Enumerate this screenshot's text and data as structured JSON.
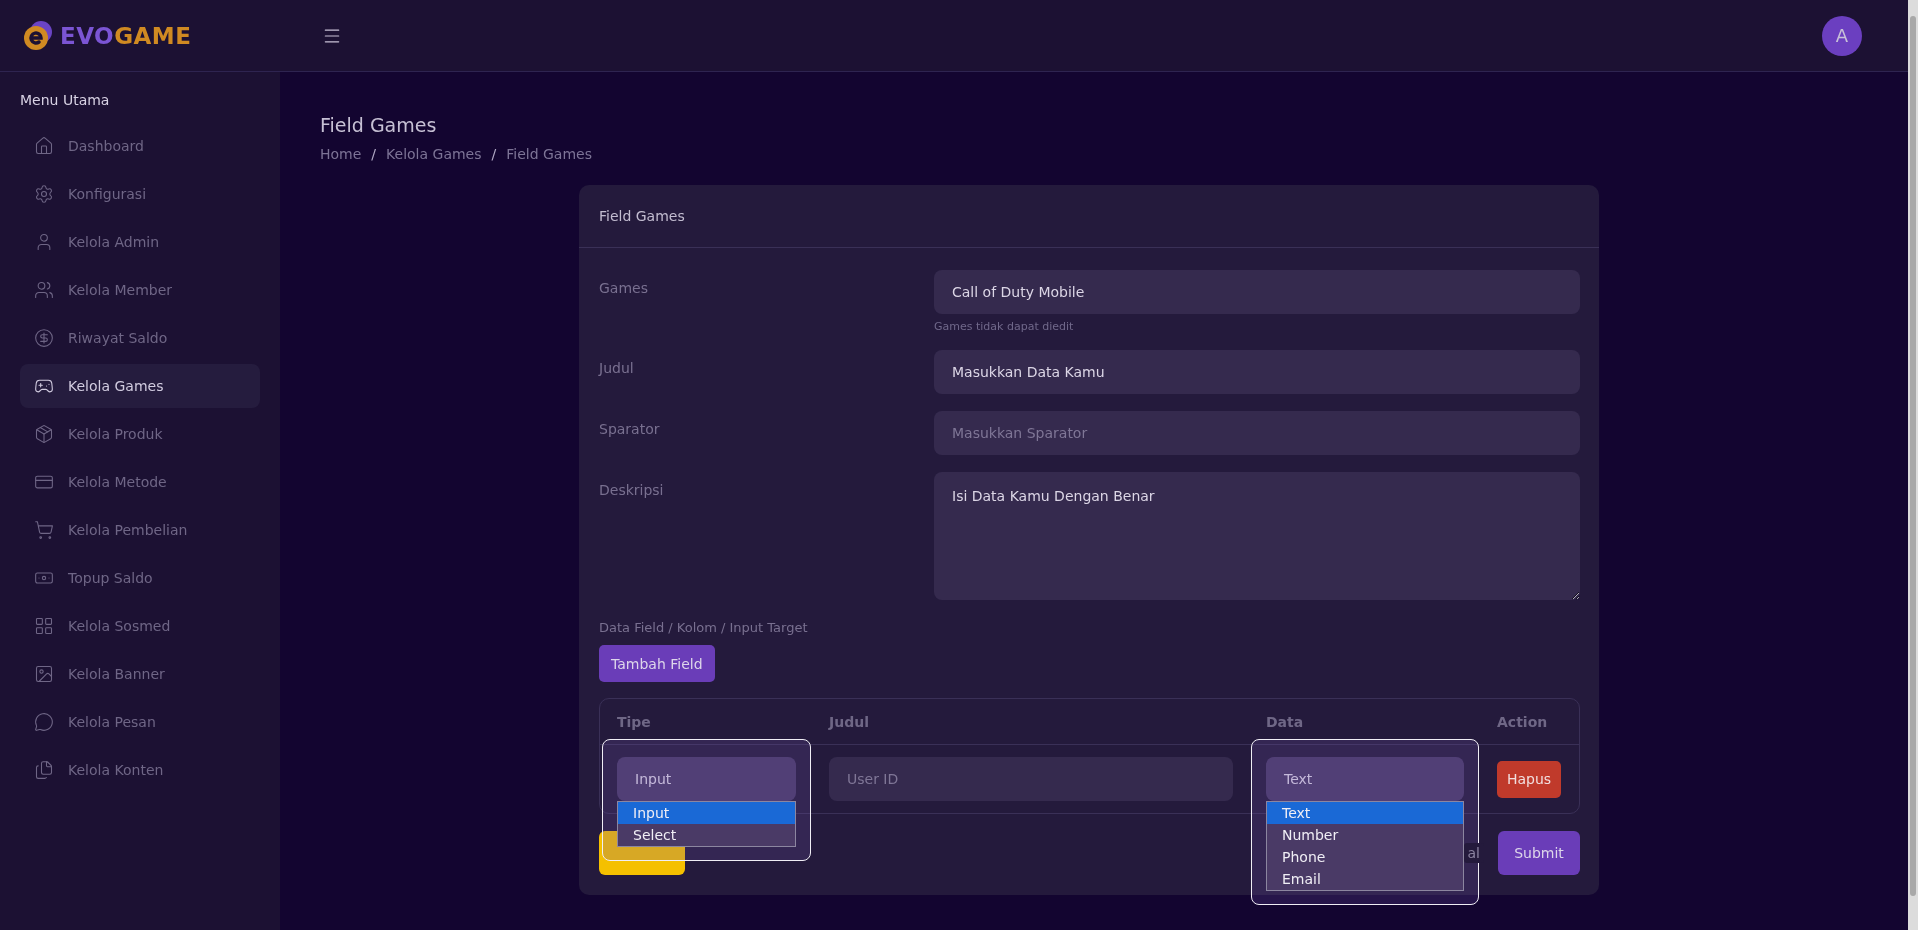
{
  "brand": {
    "logo_parts": [
      {
        "text": "EVO",
        "color": "#7b55d4"
      },
      {
        "text": "GAME",
        "color": "#d08a22"
      }
    ]
  },
  "header": {
    "avatar": "A"
  },
  "sidebar": {
    "heading": "Menu Utama",
    "items": [
      {
        "label": "Dashboard",
        "selected": false
      },
      {
        "label": "Konfigurasi",
        "selected": false
      },
      {
        "label": "Kelola Admin",
        "selected": false
      },
      {
        "label": "Kelola Member",
        "selected": false
      },
      {
        "label": "Riwayat Saldo",
        "selected": false
      },
      {
        "label": "Kelola Games",
        "selected": true
      },
      {
        "label": "Kelola Produk",
        "selected": false
      },
      {
        "label": "Kelola Metode",
        "selected": false
      },
      {
        "label": "Kelola Pembelian",
        "selected": false
      },
      {
        "label": "Topup Saldo",
        "selected": false
      },
      {
        "label": "Kelola Sosmed",
        "selected": false
      },
      {
        "label": "Kelola Banner",
        "selected": false
      },
      {
        "label": "Kelola Pesan",
        "selected": false
      },
      {
        "label": "Kelola Konten",
        "selected": false
      }
    ]
  },
  "page": {
    "title": "Field Games",
    "breadcrumb": [
      {
        "label": "Home"
      },
      {
        "separator": "/",
        "label": "Kelola Games"
      },
      {
        "separator": "/",
        "label": "Field Games"
      }
    ]
  },
  "card": {
    "title": "Field Games",
    "fields": [
      {
        "kind": "input",
        "label": "Games",
        "value": "Call of Duty Mobile",
        "help": "Games tidak dapat diedit"
      },
      {
        "kind": "input",
        "label": "Judul",
        "value": "Masukkan Data Kamu"
      },
      {
        "kind": "input",
        "label": "Sparator",
        "placeholder": "Masukkan Sparator"
      },
      {
        "kind": "textarea",
        "label": "Deskripsi",
        "value": "Isi Data Kamu Dengan Benar"
      }
    ],
    "data_fields": {
      "label": "Data Field / Kolom / Input Target",
      "add_button": "Tambah Field",
      "columns": [
        "Tipe",
        "Judul",
        "Data",
        "Action"
      ],
      "rows": [
        {
          "type": {
            "value": "Input",
            "expanded": true,
            "options": [
              {
                "label": "Input",
                "selected": true
              },
              {
                "label": "Select",
                "selected": false
              }
            ]
          },
          "title": {
            "placeholder": "User ID"
          },
          "data": {
            "value": "Text",
            "expanded": true,
            "options": [
              {
                "label": "Text",
                "selected": true
              },
              {
                "label": "Number",
                "selected": false
              },
              {
                "label": "Phone",
                "selected": false
              },
              {
                "label": "Email",
                "selected": false
              }
            ]
          },
          "action": "Hapus"
        }
      ]
    },
    "footer": {
      "cancel_text": "al",
      "submit": "Submit"
    }
  }
}
